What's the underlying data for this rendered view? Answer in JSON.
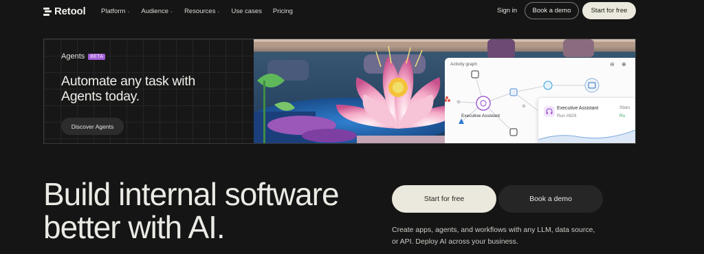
{
  "nav": {
    "brand": "Retool",
    "links": [
      {
        "label": "Platform",
        "has_menu": true
      },
      {
        "label": "Audience",
        "has_menu": true
      },
      {
        "label": "Resources",
        "has_menu": true
      },
      {
        "label": "Use cases",
        "has_menu": false
      },
      {
        "label": "Pricing",
        "has_menu": false
      }
    ],
    "sign_in": "Sign in",
    "book_demo": "Book a demo",
    "start_free": "Start for free"
  },
  "banner": {
    "label": "Agents",
    "badge": "BETA",
    "title": "Automate any task with Agents today.",
    "cta": "Discover Agents",
    "graph": {
      "title": "Activity graph",
      "node_label": "Executive Assistant",
      "card_title": "Executive Assistant",
      "card_run": "Run #829",
      "card_status_label": "Statu",
      "card_status_value": "Ru"
    }
  },
  "hero": {
    "title": "Build internal software better with AI.",
    "start_free": "Start for free",
    "book_demo": "Book a demo",
    "description": "Create apps, agents, and workflows with any LLM, data source, or API. Deploy AI across your business."
  },
  "colors": {
    "background": "#151515",
    "primary_button": "#ebe9dd",
    "beta_badge": "#a25fd6"
  }
}
